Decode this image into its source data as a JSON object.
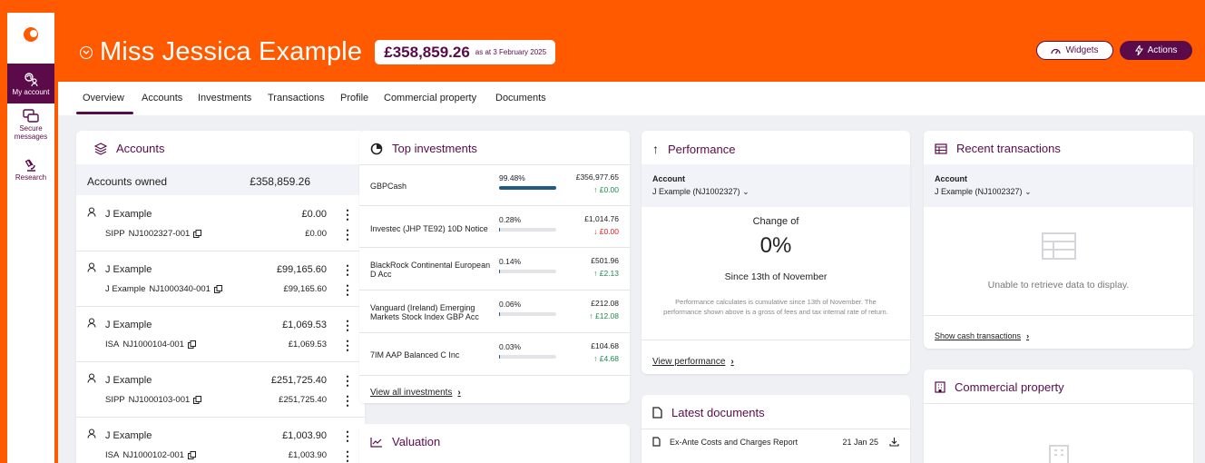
{
  "rail": {
    "my_account": "My account",
    "secure_messages": "Secure messages",
    "research": "Research"
  },
  "header": {
    "client_name": "Miss Jessica Example",
    "total_value": "£358,859.26",
    "as_at": "as at 3 February 2025",
    "widgets_label": "Widgets",
    "actions_label": "Actions"
  },
  "tabs": [
    "Overview",
    "Accounts",
    "Investments",
    "Transactions",
    "Profile",
    "Commercial property",
    "Documents"
  ],
  "accounts": {
    "title": "Accounts",
    "owned_label": "Accounts owned",
    "owned_total": "£358,859.26",
    "rows": [
      {
        "owner": "J Example",
        "balance": "£0.00",
        "type": "SIPP",
        "ref": "NJ1002327-001",
        "sub_balance": "£0.00"
      },
      {
        "owner": "J Example",
        "balance": "£99,165.60",
        "type": "J Example",
        "ref": "NJ1000340-001",
        "sub_balance": "£99,165.60"
      },
      {
        "owner": "J Example",
        "balance": "£1,069.53",
        "type": "ISA",
        "ref": "NJ1000104-001",
        "sub_balance": "£1,069.53"
      },
      {
        "owner": "J Example",
        "balance": "£251,725.40",
        "type": "SIPP",
        "ref": "NJ1000103-001",
        "sub_balance": "£251,725.40"
      },
      {
        "owner": "J Example",
        "balance": "£1,003.90",
        "type": "ISA",
        "ref": "NJ1000102-001",
        "sub_balance": "£1,003.90"
      }
    ]
  },
  "top_investments": {
    "title": "Top investments",
    "rows": [
      {
        "name": "GBPCash",
        "pct": "99.48%",
        "fraction": 0.9948,
        "value": "£356,977.65",
        "change": "£0.00",
        "dir": "up"
      },
      {
        "name": "Investec (JHP TE92) 10D Notice",
        "pct": "0.28%",
        "fraction": 0.0028,
        "value": "£1,014.76",
        "change": "£0.00",
        "dir": "down"
      },
      {
        "name": "BlackRock Continental European D Acc",
        "pct": "0.14%",
        "fraction": 0.0014,
        "value": "£501.96",
        "change": "£2.13",
        "dir": "up"
      },
      {
        "name": "Vanguard (Ireland) Emerging Markets Stock Index GBP Acc",
        "pct": "0.06%",
        "fraction": 0.0006,
        "value": "£212.08",
        "change": "£12.08",
        "dir": "up"
      },
      {
        "name": "7IM AAP Balanced C Inc",
        "pct": "0.03%",
        "fraction": 0.0003,
        "value": "£104.68",
        "change": "£4.68",
        "dir": "up"
      }
    ],
    "view_all": "View all investments"
  },
  "valuation": {
    "title": "Valuation"
  },
  "performance": {
    "title": "Performance",
    "account_label": "Account",
    "account_value": "J Example (NJ1002327)",
    "change_of": "Change of",
    "percent": "0%",
    "since": "Since 13th of November",
    "note": "Performance calculates is cumulative since 13th of November. The performance shown above is a gross of fees and tax internal rate of return.",
    "view_link": "View performance"
  },
  "latest_documents": {
    "title": "Latest documents",
    "rows": [
      {
        "name": "Ex-Ante Costs and Charges Report",
        "date": "21 Jan 25"
      }
    ]
  },
  "recent_transactions": {
    "title": "Recent transactions",
    "account_label": "Account",
    "account_value": "J Example (NJ1002327)",
    "empty_message": "Unable to retrieve data to display.",
    "show_link": "Show cash transactions"
  },
  "commercial_property": {
    "title": "Commercial property"
  },
  "colors": {
    "brand_orange": "#ff5a00",
    "brand_plum": "#5b0a4a",
    "up": "#1e8a4f",
    "down": "#d91e1e"
  }
}
